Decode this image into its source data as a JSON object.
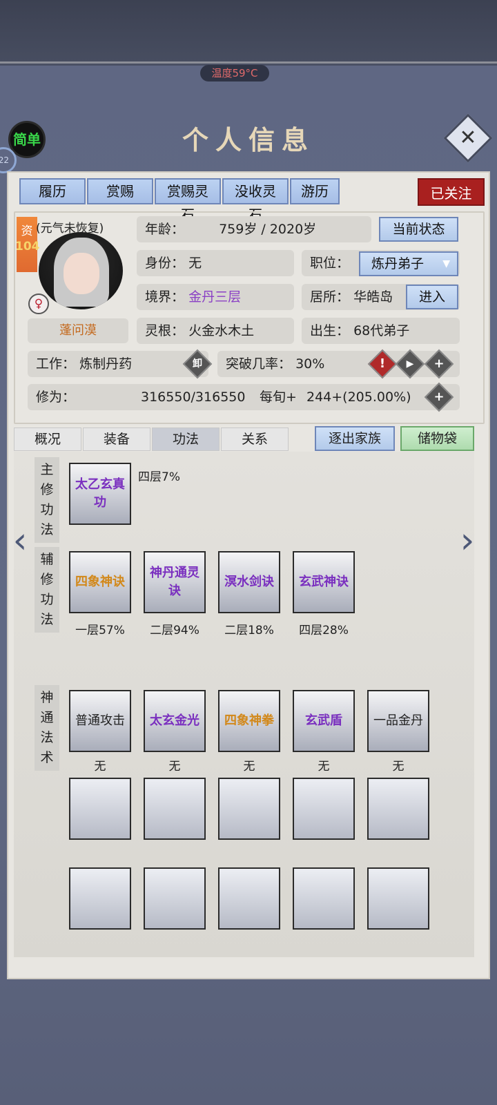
{
  "status_bar": {
    "temperature": "温度59°C"
  },
  "header": {
    "mode_button": "简单",
    "side_badge": "22",
    "title": "个人信息"
  },
  "top_tabs": [
    "履历",
    "赏赐",
    "赏赐灵石",
    "没收灵石",
    "游历"
  ],
  "follow_badge": "已关注",
  "profile": {
    "aptitude_label": "资",
    "aptitude_value": "104",
    "vitality_note": "(元气未恢复)",
    "gender_symbol": "♀",
    "name": "蓬问漠",
    "age_label": "年龄：",
    "age_value": "759岁 / 2020岁",
    "current_state_button": "当前状态",
    "identity_label": "身份：",
    "identity_value": "无",
    "position_label": "职位：",
    "position_value": "炼丹弟子",
    "realm_label": "境界：",
    "realm_value": "金丹三层",
    "residence_label": "居所：",
    "residence_value": "华皓岛",
    "enter_button": "进入",
    "root_label": "灵根：",
    "root_value": "火金水木土",
    "birth_label": "出生：",
    "birth_value": "68代弟子",
    "work_label": "工作：",
    "work_value": "炼制丹药",
    "unload_icon": "卸",
    "breakthrough_label": "突破几率：",
    "breakthrough_value": "30%",
    "cultivation_label": "修为：",
    "cultivation_value": "316550/316550",
    "per_turn_label": "每旬+",
    "per_turn_value": "244+(205.00%)"
  },
  "mid_tabs": [
    "概况",
    "装备",
    "功法",
    "关系"
  ],
  "active_mid_tab": "功法",
  "expel_button": "逐出家族",
  "bag_button": "储物袋",
  "sections": {
    "main_label": "主修功法",
    "aux_label": "辅修功法",
    "skill_label": "神通法术"
  },
  "main_skill": {
    "name": "太乙玄真功",
    "level": "四层7%",
    "color": "#7a2fbf"
  },
  "aux_skills": [
    {
      "name": "四象神诀",
      "level": "一层57%",
      "color": "#d2881a"
    },
    {
      "name": "神丹通灵诀",
      "level": "二层94%",
      "color": "#7a2fbf"
    },
    {
      "name": "溟水剑诀",
      "level": "二层18%",
      "color": "#7a2fbf"
    },
    {
      "name": "玄武神诀",
      "level": "四层28%",
      "color": "#7a2fbf"
    }
  ],
  "magic_skills": [
    {
      "name": "普通攻击",
      "level": "无",
      "color": "#222222"
    },
    {
      "name": "太玄金光",
      "level": "无",
      "color": "#7a2fbf"
    },
    {
      "name": "四象神拳",
      "level": "无",
      "color": "#d2881a"
    },
    {
      "name": "玄武盾",
      "level": "无",
      "color": "#7a2fbf"
    },
    {
      "name": "一品金丹",
      "level": "无",
      "color": "#222222"
    }
  ],
  "icons": {
    "close": "close-icon",
    "dropdown": "chevron-down-icon",
    "warning": "exclamation-icon",
    "play": "play-icon",
    "plus": "plus-icon",
    "nav_left": "chevron-left-icon",
    "nav_right": "chevron-right-icon"
  }
}
